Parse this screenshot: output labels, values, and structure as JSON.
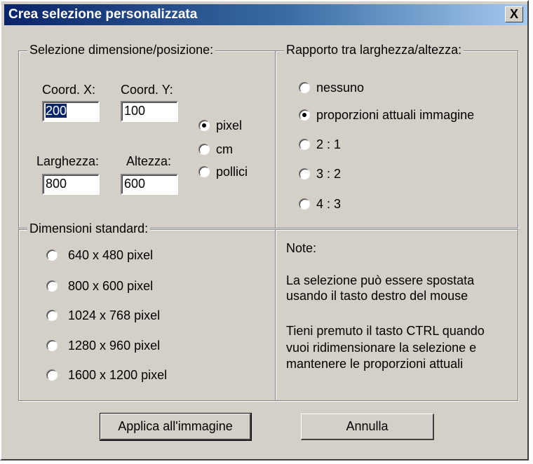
{
  "window": {
    "title": "Crea selezione personalizzata",
    "close_label": "X"
  },
  "position_group": {
    "legend": "Selezione dimensione/posizione:",
    "coord_x_label": "Coord. X:",
    "coord_y_label": "Coord. Y:",
    "coord_x_value": "200",
    "coord_y_value": "100",
    "width_label": "Larghezza:",
    "height_label": "Altezza:",
    "width_value": "800",
    "height_value": "600",
    "units": [
      {
        "label": "pixel",
        "checked": true
      },
      {
        "label": "cm",
        "checked": false
      },
      {
        "label": "pollici",
        "checked": false
      }
    ]
  },
  "ratio_group": {
    "legend": "Rapporto tra larghezza/altezza:",
    "options": [
      {
        "label": "nessuno",
        "checked": false
      },
      {
        "label": "proporzioni attuali immagine",
        "checked": true
      },
      {
        "label": "2 : 1",
        "checked": false
      },
      {
        "label": "3 : 2",
        "checked": false
      },
      {
        "label": "4 : 3",
        "checked": false
      }
    ]
  },
  "standard_group": {
    "legend": "Dimensioni standard:",
    "options": [
      {
        "label": "640 x 480 pixel",
        "checked": false
      },
      {
        "label": "800 x 600 pixel",
        "checked": false
      },
      {
        "label": "1024 x 768 pixel",
        "checked": false
      },
      {
        "label": "1280 x 960 pixel",
        "checked": false
      },
      {
        "label": "1600 x 1200 pixel",
        "checked": false
      }
    ]
  },
  "notes": {
    "title": "Note:",
    "para1_line1": "La  selezione può essere  spostata",
    "para1_line2": "usando il tasto destro del mouse",
    "para2_line1": "Tieni premuto il tasto CTRL quando",
    "para2_line2": "vuoi ridimensionare la selezione e",
    "para2_line3": "mantenere le proporzioni attuali"
  },
  "buttons": {
    "apply_label": "Applica all'immagine",
    "cancel_label": "Annulla"
  }
}
